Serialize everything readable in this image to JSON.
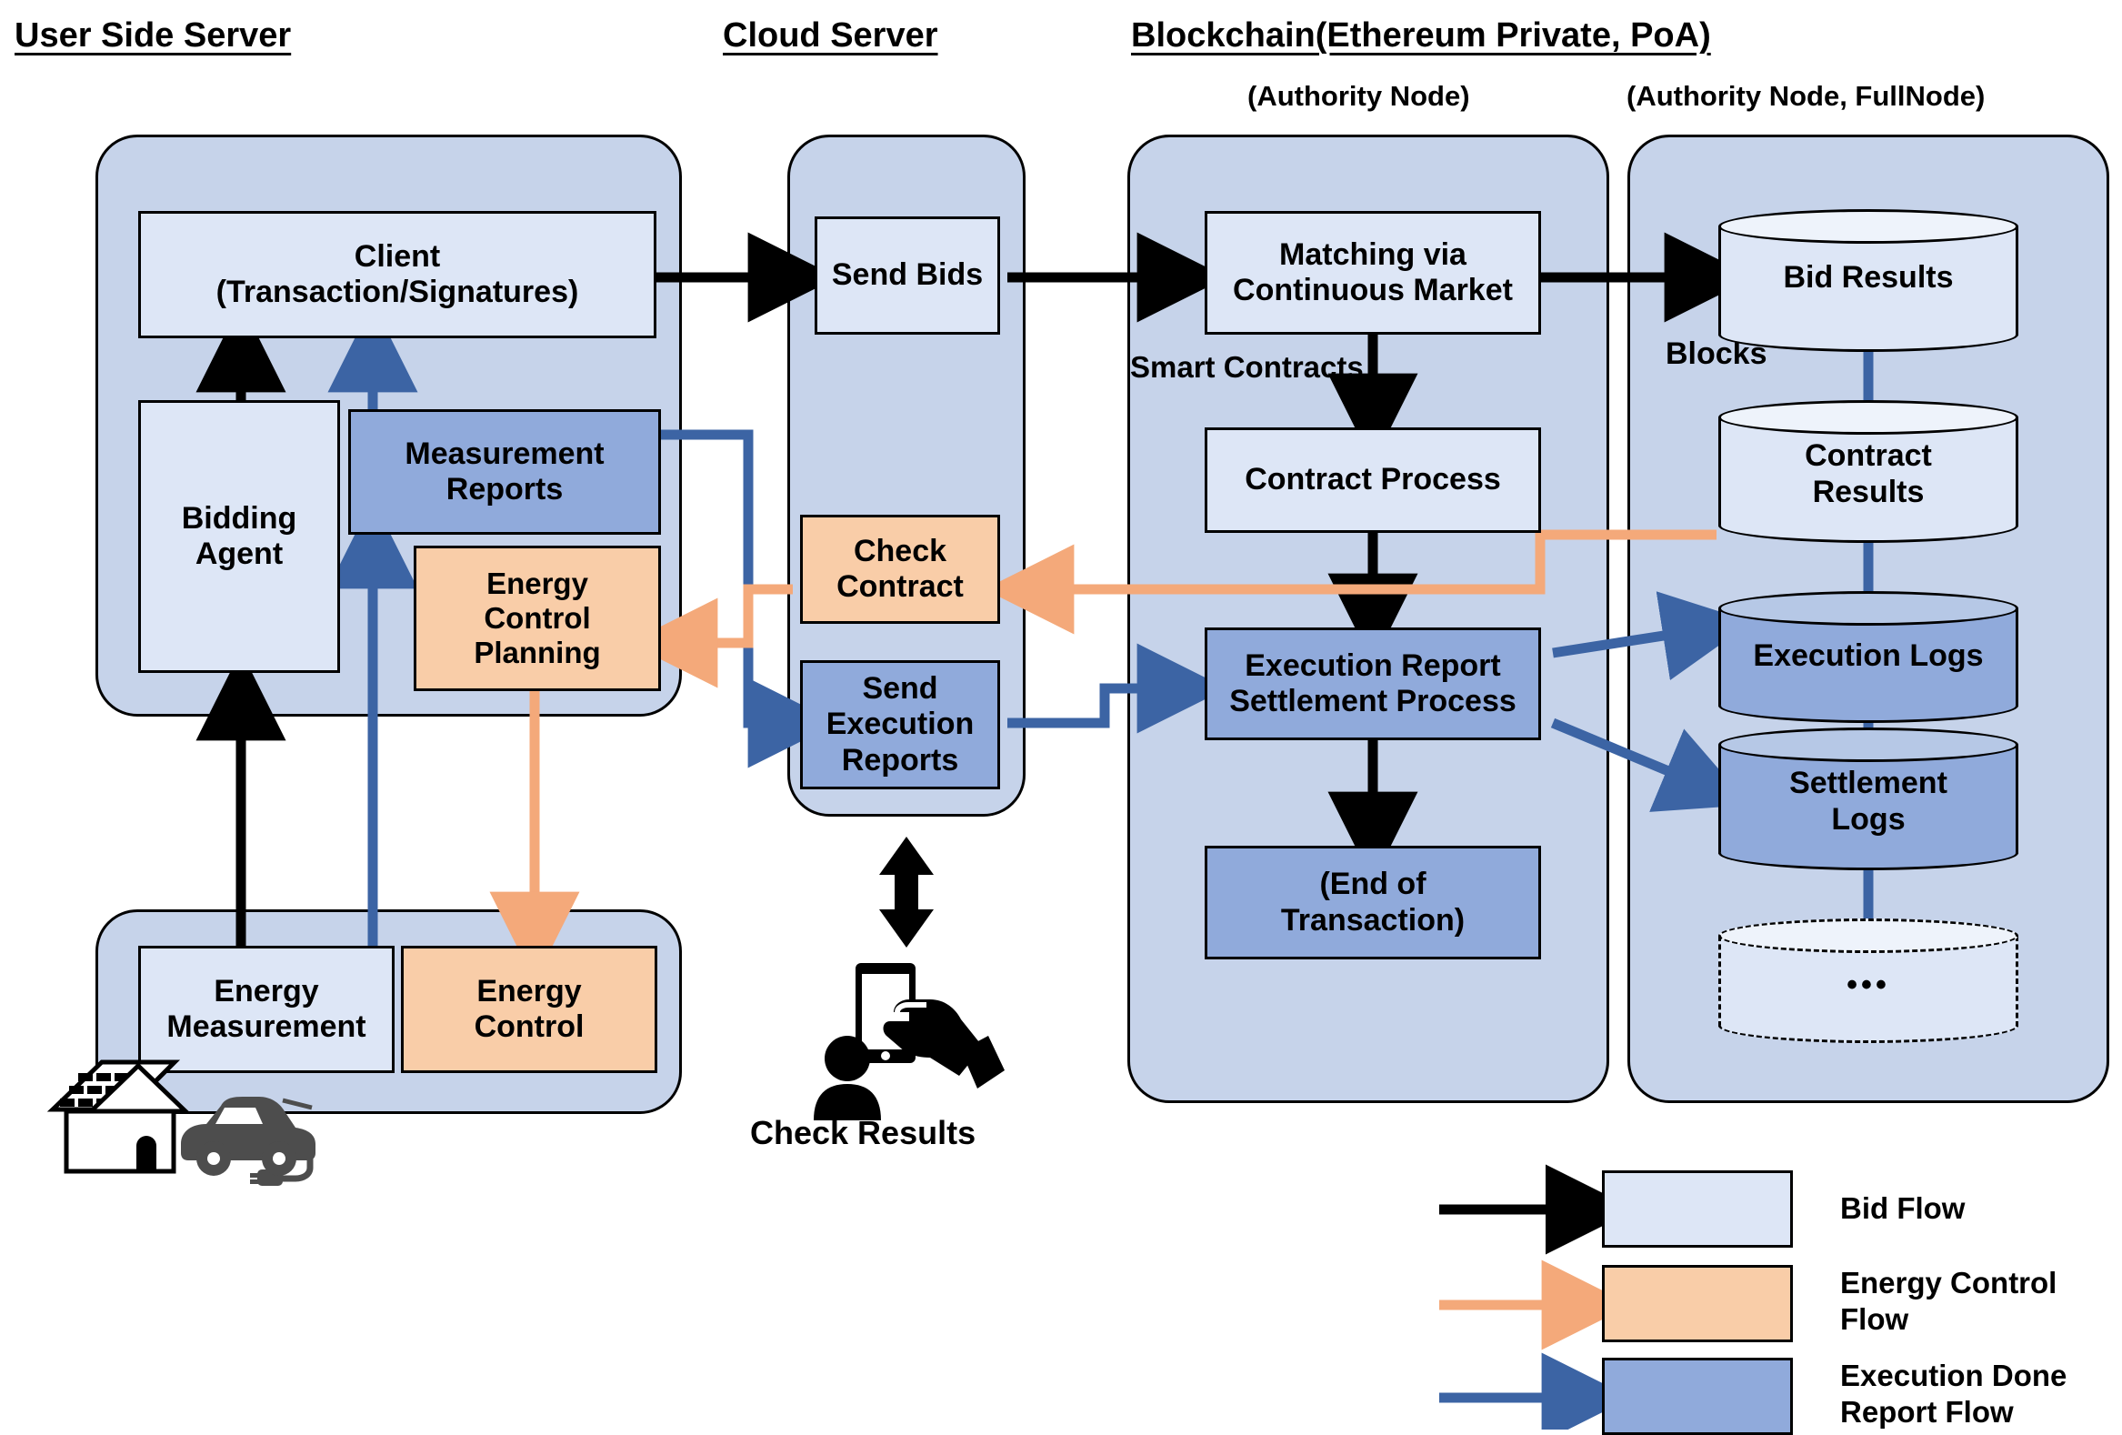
{
  "columns": {
    "user_side": {
      "title": "User Side Server"
    },
    "cloud": {
      "title": "Cloud Server"
    },
    "blockchain": {
      "title": "Blockchain(Ethereum Private, PoA)",
      "sub_authority": "(Authority Node)",
      "sub_authority_full": "(Authority Node, FullNode)"
    }
  },
  "user_side_nodes": {
    "client": "Client\n(Transaction/Signatures)",
    "client_line1": "Client",
    "client_line2": "(Transaction/Signatures)",
    "bidding_agent_l1": "Bidding",
    "bidding_agent_l2": "Agent",
    "measurement_reports_l1": "Measurement",
    "measurement_reports_l2": "Reports",
    "energy_control_planning_l1": "Energy",
    "energy_control_planning_l2": "Control",
    "energy_control_planning_l3": "Planning",
    "energy_measurement_l1": "Energy",
    "energy_measurement_l2": "Measurement",
    "energy_control_l1": "Energy",
    "energy_control_l2": "Control"
  },
  "cloud_nodes": {
    "send_bids": "Send Bids",
    "check_contract_l1": "Check",
    "check_contract_l2": "Contract",
    "send_execution_reports_l1": "Send",
    "send_execution_reports_l2": "Execution",
    "send_execution_reports_l3": "Reports",
    "check_results_label": "Check Results"
  },
  "blockchain_nodes": {
    "matching_l1": "Matching via",
    "matching_l2": "Continuous Market",
    "smart_contracts_label": "Smart Contracts",
    "contract_process": "Contract Process",
    "execution_settlement_l1": "Execution Report",
    "execution_settlement_l2": "Settlement Process",
    "end_of_transaction_l1": "(End of",
    "end_of_transaction_l2": "Transaction)"
  },
  "ledger_nodes": {
    "blocks_label": "Blocks",
    "bid_results": "Bid Results",
    "contract_results_l1": "Contract",
    "contract_results_l2": "Results",
    "execution_logs": "Execution Logs",
    "settlement_logs_l1": "Settlement",
    "settlement_logs_l2": "Logs",
    "ellipsis": "•••"
  },
  "legend": {
    "items": [
      {
        "label_l1": "Bid Flow",
        "label_l2": "",
        "arrow_color": "#000000",
        "swatch_color": "#dde6f6"
      },
      {
        "label_l1": "Energy Control",
        "label_l2": "Flow",
        "arrow_color": "#f4a97a",
        "swatch_color": "#f9cda8"
      },
      {
        "label_l1": "Execution Done",
        "label_l2": "Report Flow",
        "arrow_color": "#3c64a4",
        "swatch_color": "#90aadb"
      }
    ]
  },
  "colors": {
    "panel_fill": "#c6d3ea",
    "light_box": "#dde6f6",
    "mid_box": "#90aadb",
    "orange_box": "#f9cda8",
    "bid_flow_arrow": "#000000",
    "energy_flow_arrow": "#f4a97a",
    "execution_flow_arrow": "#3c64a4"
  },
  "icons": {
    "solar_house": "solar-house-icon",
    "electric_car": "electric-car-icon",
    "updown_arrow": "up-down-arrow-icon",
    "phone_in_hand": "phone-in-hand-icon",
    "person": "person-icon"
  }
}
